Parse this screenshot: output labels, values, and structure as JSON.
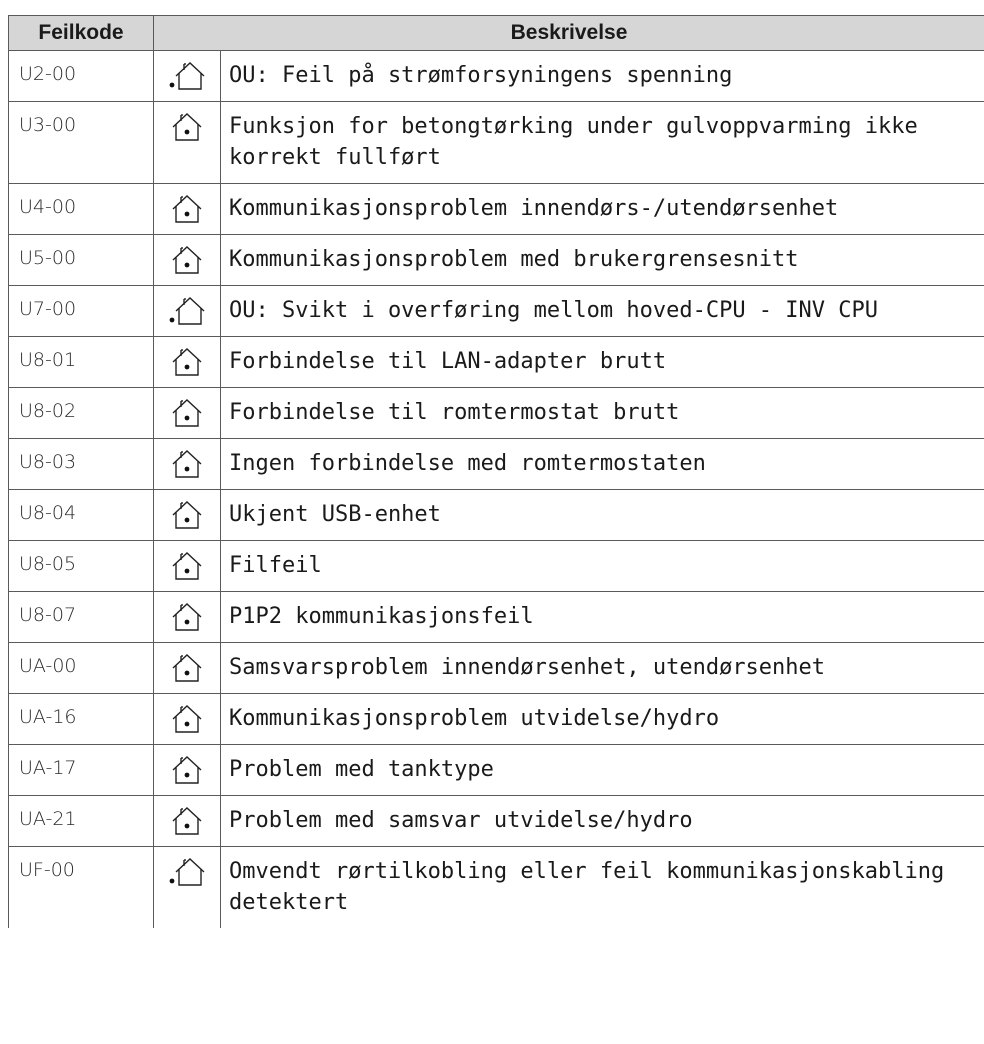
{
  "header": {
    "code_label": "Feilkode",
    "description_label": "Beskrivelse"
  },
  "rows": [
    {
      "code": "U2-00",
      "icon": "outdoor-unit-house-icon",
      "description": "OU: Feil på strømforsyningens spenning"
    },
    {
      "code": "U3-00",
      "icon": "indoor-unit-house-icon",
      "description": "Funksjon for betongtørking under gulvoppvarming ikke korrekt fullført"
    },
    {
      "code": "U4-00",
      "icon": "indoor-unit-house-icon",
      "description": "Kommunikasjonsproblem innendørs-/utendørsenhet"
    },
    {
      "code": "U5-00",
      "icon": "indoor-unit-house-icon",
      "description": "Kommunikasjonsproblem med brukergrensesnitt"
    },
    {
      "code": "U7-00",
      "icon": "outdoor-unit-house-icon",
      "description": "OU: Svikt i overføring mellom hoved-CPU - INV CPU"
    },
    {
      "code": "U8-01",
      "icon": "indoor-unit-house-icon",
      "description": "Forbindelse til LAN-adapter brutt"
    },
    {
      "code": "U8-02",
      "icon": "indoor-unit-house-icon",
      "description": "Forbindelse til romtermostat brutt"
    },
    {
      "code": "U8-03",
      "icon": "indoor-unit-house-icon",
      "description": "Ingen forbindelse med romtermostaten"
    },
    {
      "code": "U8-04",
      "icon": "indoor-unit-house-icon",
      "description": "Ukjent USB-enhet"
    },
    {
      "code": "U8-05",
      "icon": "indoor-unit-house-icon",
      "description": "Filfeil"
    },
    {
      "code": "U8-07",
      "icon": "indoor-unit-house-icon",
      "description": "P1P2 kommunikasjonsfeil"
    },
    {
      "code": "UA-00",
      "icon": "indoor-unit-house-icon",
      "description": "Samsvarsproblem innendørsenhet, utendørsenhet"
    },
    {
      "code": "UA-16",
      "icon": "indoor-unit-house-icon",
      "description": "Kommunikasjonsproblem utvidelse/hydro"
    },
    {
      "code": "UA-17",
      "icon": "indoor-unit-house-icon",
      "description": "Problem med tanktype"
    },
    {
      "code": "UA-21",
      "icon": "indoor-unit-house-icon",
      "description": "Problem med samsvar utvidelse/hydro"
    },
    {
      "code": "UF-00",
      "icon": "outdoor-unit-house-icon",
      "description": "Omvendt rørtilkobling eller feil kommunikasjonskabling detektert"
    }
  ]
}
